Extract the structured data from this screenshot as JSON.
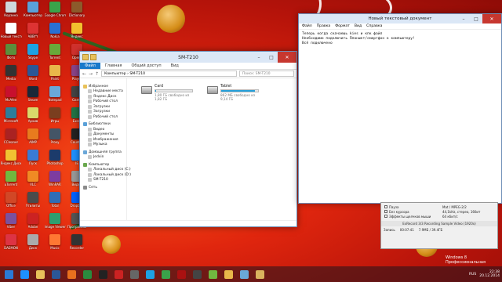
{
  "desktop_icons": [
    {
      "label": "Корзина",
      "color": "#cfd8dc"
    },
    {
      "label": "Компьютер",
      "color": "#5aa0d8"
    },
    {
      "label": "Google Chrome",
      "color": "#3aa34a"
    },
    {
      "label": "Dictionary",
      "color": "#8c5a2b"
    },
    {
      "label": "Новый текстовый",
      "color": "#ffffff"
    },
    {
      "label": "ABBYY",
      "color": "#d33"
    },
    {
      "label": "Nokia",
      "color": "#2a6fd3"
    },
    {
      "label": "Яндекс",
      "color": "#f2c12e"
    },
    {
      "label": "Фото",
      "color": "#5b8f3c"
    },
    {
      "label": "Skype",
      "color": "#1da1e3"
    },
    {
      "label": "Torrent",
      "color": "#68a93a"
    },
    {
      "label": "Opera",
      "color": "#d0312d"
    },
    {
      "label": "Media",
      "color": "#333333"
    },
    {
      "label": "Word",
      "color": "#2b5797"
    },
    {
      "label": "Paint",
      "color": "#e9b84a"
    },
    {
      "label": "Player",
      "color": "#884488"
    },
    {
      "label": "McAfee",
      "color": "#c8102e"
    },
    {
      "label": "Steam",
      "color": "#1b2838"
    },
    {
      "label": "Notepad",
      "color": "#6aa7d8"
    },
    {
      "label": "Game",
      "color": "#444444"
    },
    {
      "label": "Microsoft",
      "color": "#2d7d9a"
    },
    {
      "label": "Архив",
      "color": "#d9d96a"
    },
    {
      "label": "Игры",
      "color": "#7a3e1f"
    },
    {
      "label": "Excel",
      "color": "#217346"
    },
    {
      "label": "CCleaner",
      "color": "#aa2222"
    },
    {
      "label": "AIMP",
      "color": "#e87b1e"
    },
    {
      "label": "Proxy",
      "color": "#445566"
    },
    {
      "label": "Counter",
      "color": "#222222"
    },
    {
      "label": "Яндекс Диск",
      "color": "#f1c232"
    },
    {
      "label": "Пуск",
      "color": "#3a7bd5"
    },
    {
      "label": "Photoshop",
      "color": "#1c3b6b"
    },
    {
      "label": "IE",
      "color": "#1e90ff"
    },
    {
      "label": "uTorrent",
      "color": "#71b83f"
    },
    {
      "label": "VLC",
      "color": "#f08a24"
    },
    {
      "label": "WinRAR",
      "color": "#7d3ca0"
    },
    {
      "label": "Видео",
      "color": "#999999"
    },
    {
      "label": "Office",
      "color": "#d24726"
    },
    {
      "label": "Утилиты",
      "color": "#4b4b4b"
    },
    {
      "label": "Total",
      "color": "#2f6db5"
    },
    {
      "label": "Dropbox",
      "color": "#0061fe"
    },
    {
      "label": "Viber",
      "color": "#7b519d"
    },
    {
      "label": "Adobe",
      "color": "#cc2222"
    },
    {
      "label": "Image Viewer",
      "color": "#2f9f6f"
    },
    {
      "label": "Программы",
      "color": "#555555"
    },
    {
      "label": "DAEMON",
      "color": "#dd3344"
    },
    {
      "label": "Диск",
      "color": "#aaaaaa"
    },
    {
      "label": "Music",
      "color": "#ff7733"
    },
    {
      "label": "Recorder",
      "color": "#333333"
    }
  ],
  "explorer": {
    "title": "SM-T210",
    "ribbon": {
      "file": "Файл",
      "tabs": [
        "Главная",
        "Общий доступ",
        "Вид"
      ]
    },
    "address": "Компьютер  ›  SM-T210",
    "search_placeholder": "Поиск: SM-T210",
    "nav_groups": [
      {
        "label": "Избранное",
        "items": [
          "Недавние места",
          "Яндекс.Диск",
          "Рабочий стол",
          "Загрузки",
          "Загрузки",
          "Рабочий стол"
        ]
      },
      {
        "label": "Библиотеки",
        "items": [
          "Видео",
          "Документы",
          "Изображения",
          "Музыка"
        ]
      },
      {
        "label": "Домашняя группа",
        "items": [
          "Jedvin"
        ]
      },
      {
        "label": "Компьютер",
        "items": [
          "Локальный диск (C:)",
          "Локальный диск (D:)",
          "SM-T210"
        ]
      },
      {
        "label": "Сеть",
        "items": []
      }
    ],
    "drives": [
      {
        "name": "Card",
        "free": "1,80 ГБ свободно из 1,82 ГБ",
        "used_fraction": 0.01
      },
      {
        "name": "Tablet",
        "free": "862 МБ свободно из 9,14 ГБ",
        "used_fraction": 0.91
      }
    ]
  },
  "notepad": {
    "title": "Новый текстовый документ",
    "menu": [
      "Файл",
      "Правка",
      "Формат",
      "Вид",
      "Справка"
    ],
    "text": "Теперь когда скачаешь kies и кпк файл\nНеобходимо подключить Планшет/смартфон к компьютеру!\nВсё подключено"
  },
  "recorder": {
    "options": [
      "Пауза",
      "Без курсора",
      "Эффекты щелчков мыши"
    ],
    "settings": [
      "Mat / MPEG-2/2",
      "44,1kHz, стерео, 16бит",
      "64 кбит/с"
    ],
    "title": "ExRecord 3/3 Recording Sample Video (1920x)",
    "status": [
      "Запись",
      "00:07:41",
      "7.9МБ / 39.4ГБ"
    ]
  },
  "watermark": "Windows 8 Профессиональная",
  "taskbar": {
    "apps": [
      {
        "name": "ie",
        "color": "#1e90ff"
      },
      {
        "name": "explorer",
        "color": "#e8c15a"
      },
      {
        "name": "word",
        "color": "#2b5797"
      },
      {
        "name": "firefox",
        "color": "#e8701e"
      },
      {
        "name": "store",
        "color": "#2a8a3e"
      },
      {
        "name": "terminal",
        "color": "#222222"
      },
      {
        "name": "yandex",
        "color": "#cc2222"
      },
      {
        "name": "media",
        "color": "#666666"
      },
      {
        "name": "skype",
        "color": "#1da1e3"
      },
      {
        "name": "chrome",
        "color": "#3aa34a"
      },
      {
        "name": "recorder",
        "color": "#aa1111"
      },
      {
        "name": "player",
        "color": "#444444"
      },
      {
        "name": "utorrent",
        "color": "#71b83f"
      },
      {
        "name": "paint",
        "color": "#e9b84a"
      },
      {
        "name": "notepad",
        "color": "#6aa7d8"
      },
      {
        "name": "folder",
        "color": "#d9b25e"
      }
    ],
    "lang": "RUS",
    "time": "22:38",
    "date": "20.12.2014"
  }
}
